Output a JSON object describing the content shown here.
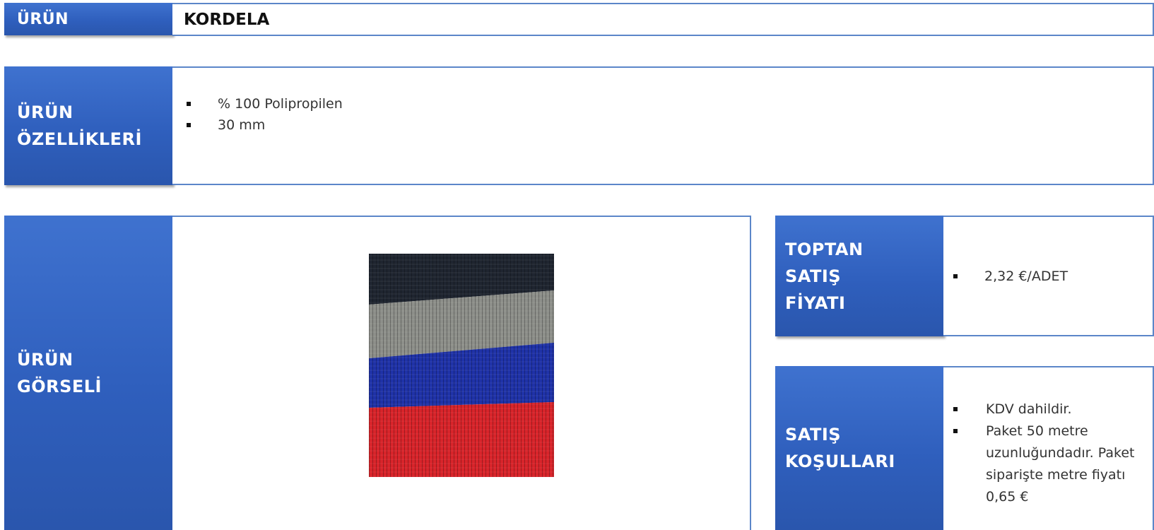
{
  "product": {
    "label": "ÜRÜN",
    "name": "KORDELA"
  },
  "features": {
    "label_lines": [
      "ÜRÜN",
      "ÖZELLİKLERİ"
    ],
    "items": [
      "% 100 Polipropilen",
      "30 mm"
    ]
  },
  "image": {
    "label_lines": [
      "ÜRÜN",
      "GÖRSELİ"
    ],
    "stripe_colors": [
      "#1f2530",
      "#8d8f8a",
      "#1f32a8",
      "#d8242a"
    ]
  },
  "wholesale": {
    "label_lines": [
      "TOPTAN",
      "SATIŞ",
      "FİYATI"
    ],
    "items": [
      "2,32 €/ADET"
    ]
  },
  "terms": {
    "label_lines": [
      "SATIŞ",
      "KOŞULLARI"
    ],
    "items": [
      "KDV dahildir.",
      "Paket 50 metre uzunluğundadır. Paket siparişte metre fiyatı 0,65 €"
    ]
  },
  "colors": {
    "label_blue": "#2f5fbd",
    "border_blue": "#5b86c9"
  }
}
